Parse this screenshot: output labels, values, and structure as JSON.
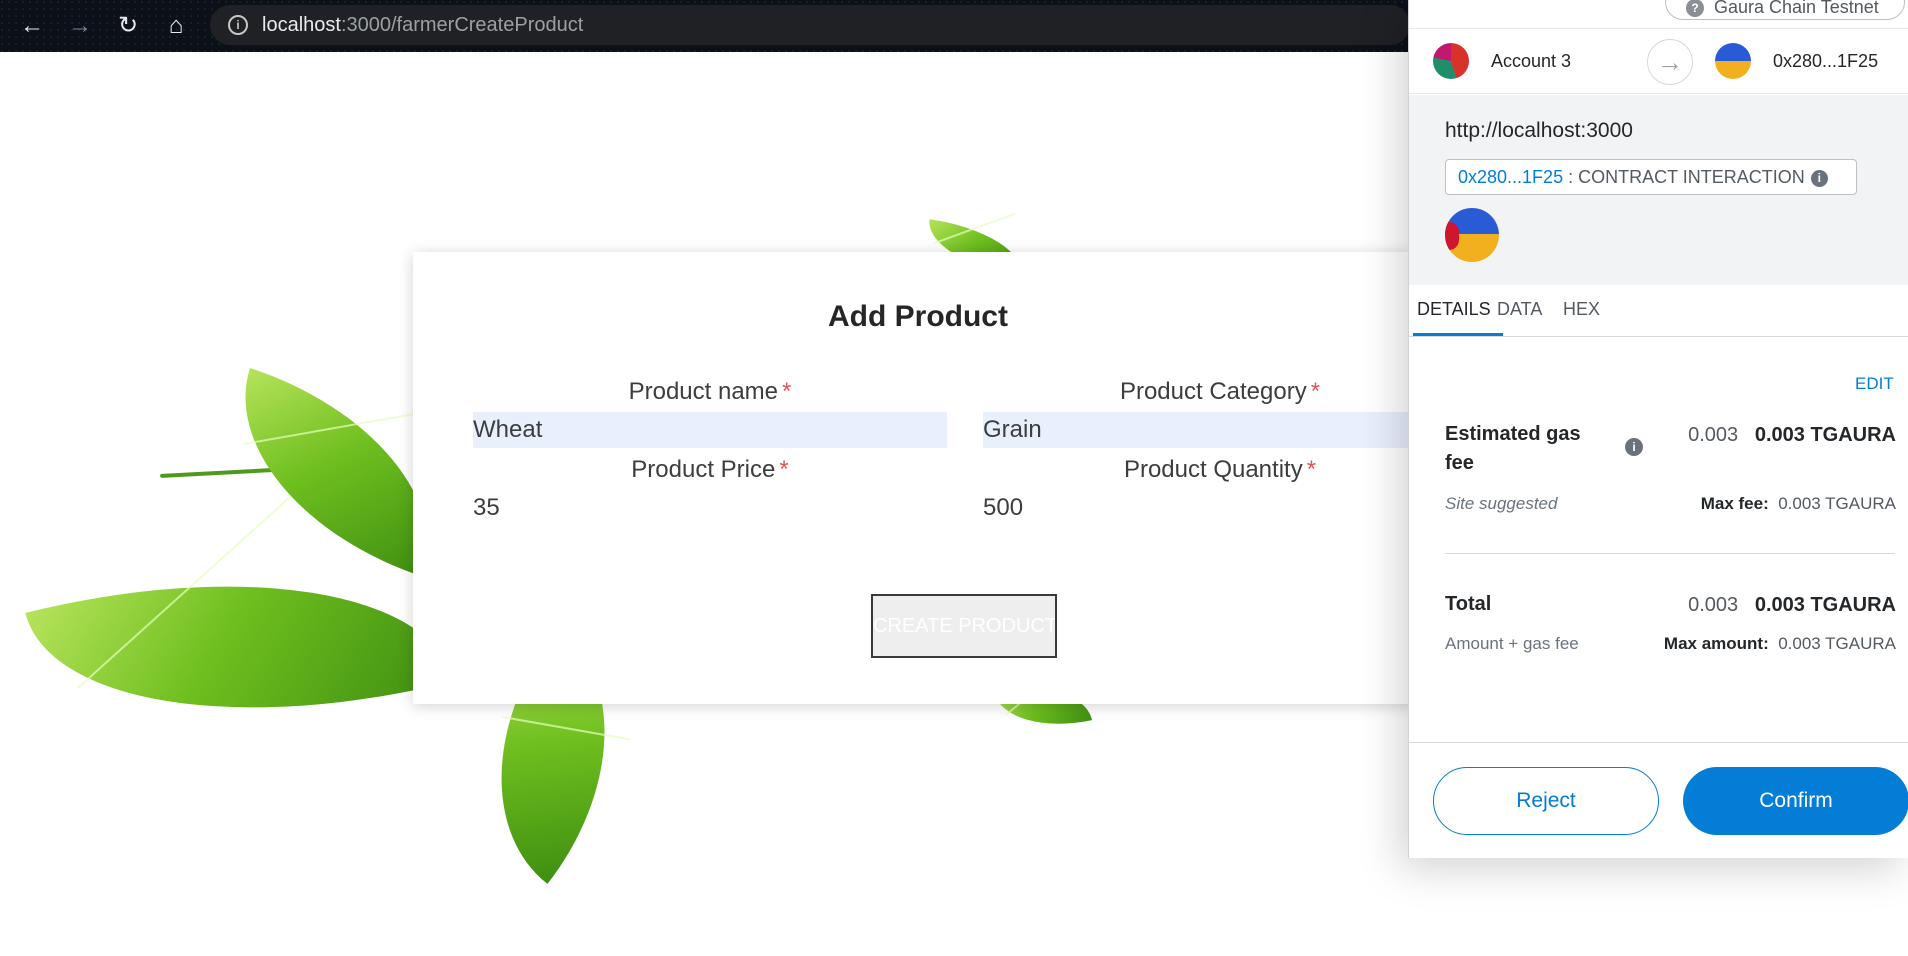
{
  "browser": {
    "back_icon": "←",
    "forward_icon": "→",
    "reload_icon": "↻",
    "home_icon": "⌂",
    "url_host": "localhost",
    "url_path": ":3000/farmerCreateProduct"
  },
  "form": {
    "title": "Add Product",
    "required_mark": "*",
    "product_name_label": "Product name",
    "product_name_value": "Wheat",
    "product_category_label": "Product Category",
    "product_category_value": "Grain",
    "product_price_label": "Product Price",
    "product_price_value": "35",
    "product_quantity_label": "Product Quantity",
    "product_quantity_value": "500",
    "create_button": "CREATE PRODUCT"
  },
  "metamask": {
    "network": "Gaura Chain Testnet",
    "account_name": "Account 3",
    "to_address": "0x280...1F25",
    "origin": "http://localhost:3000",
    "contract_address": "0x280...1F25",
    "contract_separator": " : ",
    "contract_label": "CONTRACT INTERACTION",
    "tabs": [
      "DETAILS",
      "DATA",
      "HEX"
    ],
    "edit_label": "EDIT",
    "gas_fee_label": "Estimated gas fee",
    "gas_fee_value": "0.003",
    "gas_fee_bold": "0.003 TGAURA",
    "site_suggested": "Site suggested",
    "max_fee_label": "Max fee:",
    "max_fee_value": "0.003 TGAURA",
    "total_label": "Total",
    "total_value": "0.003",
    "total_bold": "0.003 TGAURA",
    "amount_gas_label": "Amount + gas fee",
    "max_amount_label": "Max amount:",
    "max_amount_value": "0.003 TGAURA",
    "reject_button": "Reject",
    "confirm_button": "Confirm"
  },
  "colors": {
    "accent": "#037dd6",
    "required": "#e05555",
    "autofill": "#e8f0fe",
    "leaf_green": "#6fbf1f"
  }
}
